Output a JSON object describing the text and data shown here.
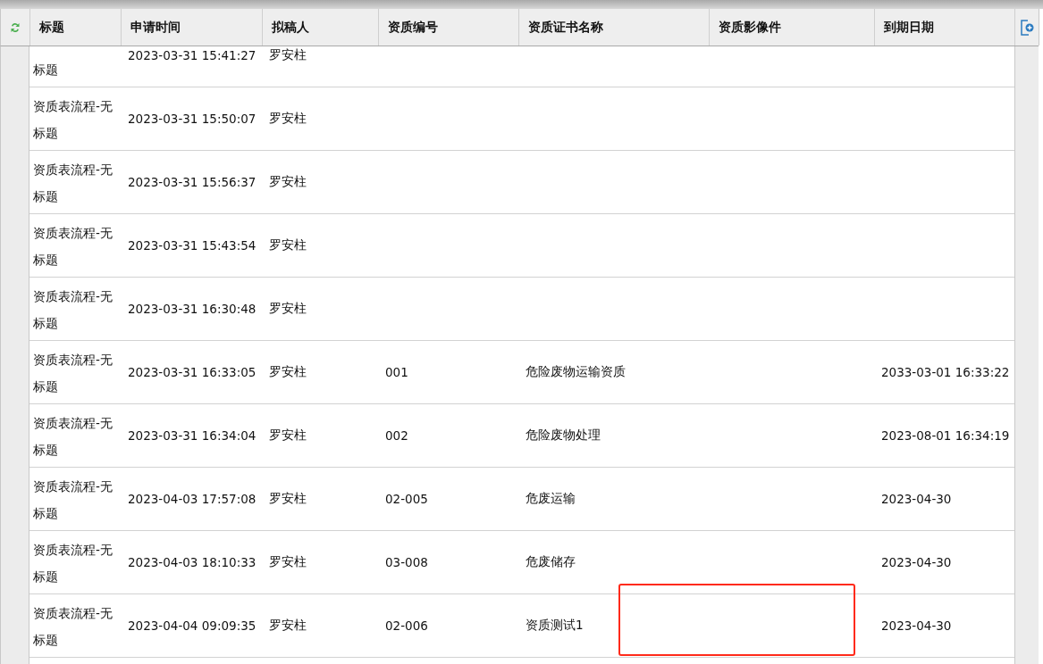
{
  "table": {
    "columns": [
      "标题",
      "申请时间",
      "拟稿人",
      "资质编号",
      "资质证书名称",
      "资质影像件",
      "到期日期"
    ],
    "rows": [
      {
        "title": "标题",
        "time": "2023-03-31 15:41:27",
        "drafter": "罗安柱",
        "number": "",
        "cert_name": "",
        "expiry": "",
        "highlighted": false
      },
      {
        "title": "资质表流程-无标题",
        "time": "2023-03-31 15:50:07",
        "drafter": "罗安柱",
        "number": "",
        "cert_name": "",
        "expiry": "",
        "highlighted": false
      },
      {
        "title": "资质表流程-无标题",
        "time": "2023-03-31 15:56:37",
        "drafter": "罗安柱",
        "number": "",
        "cert_name": "",
        "expiry": "",
        "highlighted": false
      },
      {
        "title": "资质表流程-无标题",
        "time": "2023-03-31 15:43:54",
        "drafter": "罗安柱",
        "number": "",
        "cert_name": "",
        "expiry": "",
        "highlighted": false
      },
      {
        "title": "资质表流程-无标题",
        "time": "2023-03-31 16:30:48",
        "drafter": "罗安柱",
        "number": "",
        "cert_name": "",
        "expiry": "",
        "highlighted": false
      },
      {
        "title": "资质表流程-无标题",
        "time": "2023-03-31 16:33:05",
        "drafter": "罗安柱",
        "number": "001",
        "cert_name": "危险废物运输资质",
        "expiry": "2033-03-01 16:33:22",
        "highlighted": false
      },
      {
        "title": "资质表流程-无标题",
        "time": "2023-03-31 16:34:04",
        "drafter": "罗安柱",
        "number": "002",
        "cert_name": "危险废物处理",
        "expiry": "2023-08-01 16:34:19",
        "highlighted": false
      },
      {
        "title": "资质表流程-无标题",
        "time": "2023-04-03 17:57:08",
        "drafter": "罗安柱",
        "number": "02-005",
        "cert_name": "危废运输",
        "expiry": "2023-04-30",
        "highlighted": false
      },
      {
        "title": "资质表流程-无标题",
        "time": "2023-04-03 18:10:33",
        "drafter": "罗安柱",
        "number": "03-008",
        "cert_name": "危废储存",
        "expiry": "2023-04-30",
        "highlighted": false
      },
      {
        "title": "资质表流程-无标题",
        "time": "2023-04-04 09:09:35",
        "drafter": "罗安柱",
        "number": "02-006",
        "cert_name": "资质测试1",
        "expiry": "2023-04-30",
        "highlighted": true
      }
    ]
  }
}
